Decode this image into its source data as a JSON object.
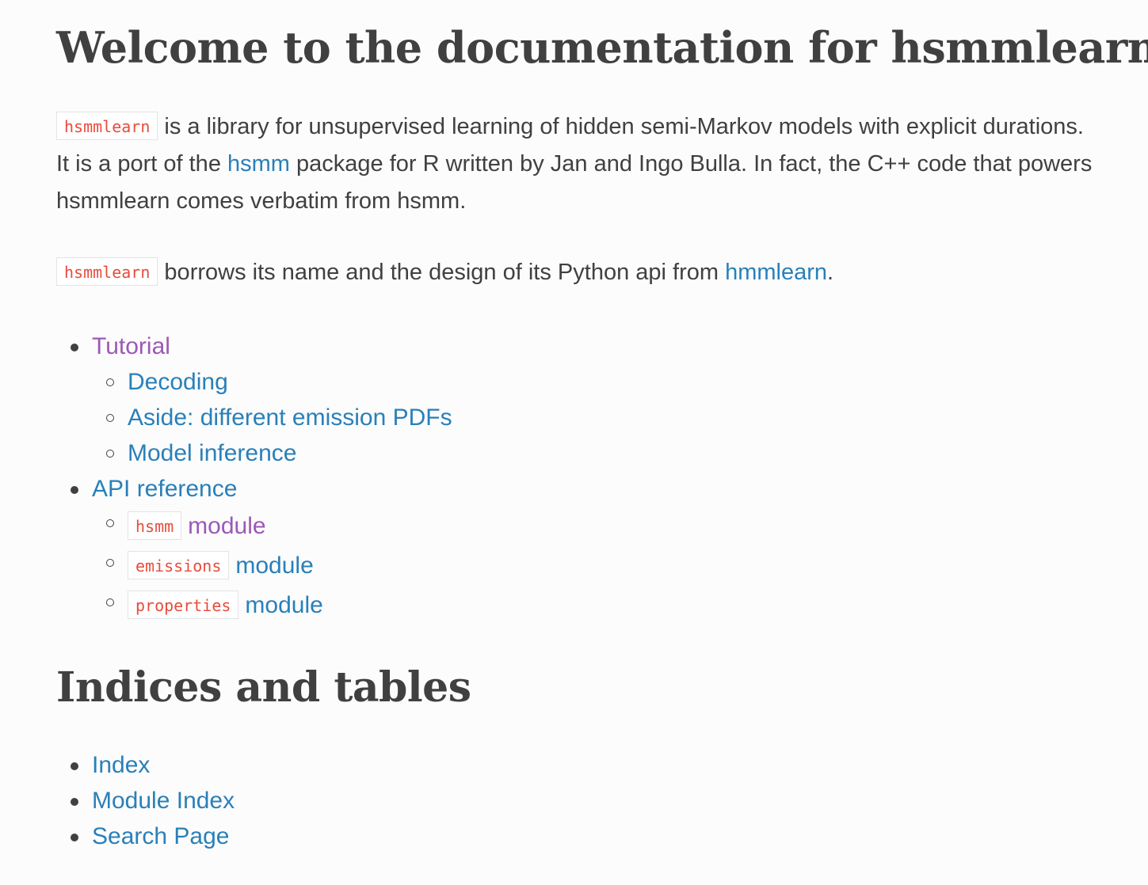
{
  "title": "Welcome to the documentation for hsmmlearn!",
  "intro": {
    "code": "hsmmlearn",
    "text1": " is a library for unsupervised learning of hidden semi-Markov models with explicit durations. It is a port of the ",
    "link": "hsmm",
    "text2": " package for R written by Jan and Ingo Bulla. In fact, the C++ code that powers hsmmlearn comes verbatim from hsmm."
  },
  "borrow": {
    "code": "hsmmlearn",
    "text1": " borrows its name and the design of its Python api from ",
    "link": "hmmlearn",
    "text2": "."
  },
  "toc": {
    "tutorial": {
      "label": "Tutorial",
      "children": [
        "Decoding",
        "Aside: different emission PDFs",
        "Model inference"
      ]
    },
    "api": {
      "label": "API reference",
      "modules": [
        {
          "code": "hsmm",
          "label": "module"
        },
        {
          "code": "emissions",
          "label": "module"
        },
        {
          "code": "properties",
          "label": "module"
        }
      ]
    }
  },
  "indices": {
    "title": "Indices and tables",
    "items": [
      "Index",
      "Module Index",
      "Search Page"
    ]
  },
  "colors": {
    "link": "#2980b9",
    "visited": "#9b59b6",
    "code": "#e74c3c",
    "text": "#404040",
    "background": "#fcfcfc"
  }
}
